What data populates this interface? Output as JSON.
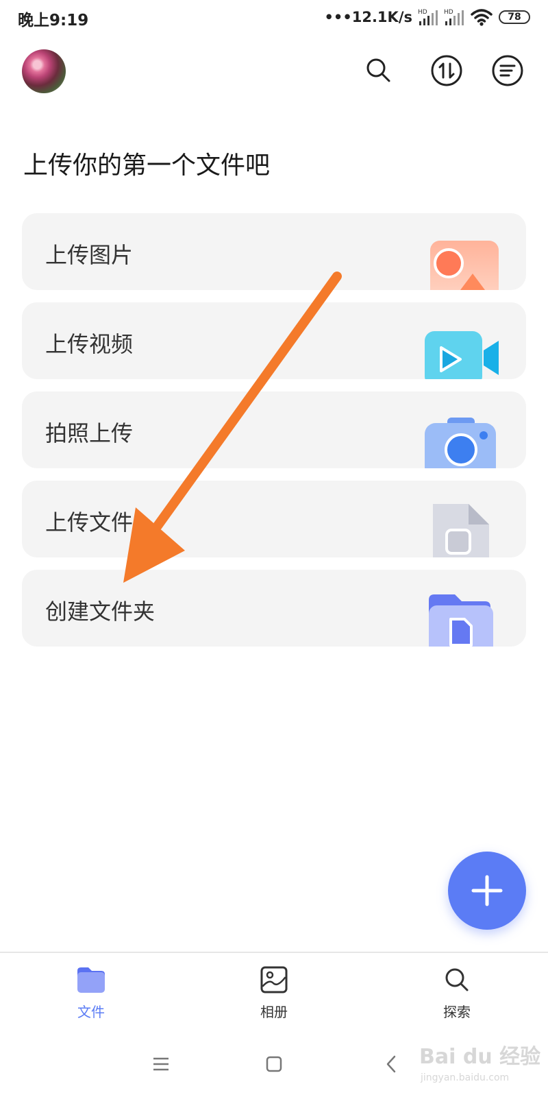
{
  "status_bar": {
    "time": "晚上9:19",
    "net_speed": "•••12.1K/s",
    "signal_1": "HD",
    "signal_2": "HD",
    "battery": "78"
  },
  "header": {
    "avatar": "avatar",
    "search_icon": "search-icon",
    "sort_icon": "sort-icon",
    "menu_icon": "menu-icon"
  },
  "main": {
    "heading": "上传你的第一个文件吧",
    "cards": [
      {
        "label": "上传图片",
        "icon": "image-icon"
      },
      {
        "label": "上传视频",
        "icon": "video-icon"
      },
      {
        "label": "拍照上传",
        "icon": "camera-icon"
      },
      {
        "label": "上传文件",
        "icon": "file-icon"
      },
      {
        "label": "创建文件夹",
        "icon": "folder-icon"
      }
    ]
  },
  "annotation": {
    "arrow_color": "#f47a2a"
  },
  "fab": {
    "icon": "plus-icon",
    "color": "#5b7cf5"
  },
  "bottom_nav": {
    "items": [
      {
        "label": "文件",
        "icon": "folder-icon",
        "active": true
      },
      {
        "label": "相册",
        "icon": "album-icon",
        "active": false
      },
      {
        "label": "探索",
        "icon": "search-icon",
        "active": false
      }
    ]
  },
  "system_nav": {
    "menu": "menu-icon",
    "home": "home-icon",
    "back": "back-icon"
  },
  "watermark": {
    "brand": "Bai du 经验",
    "url": "jingyan.baidu.com"
  },
  "colors": {
    "accent": "#5b7cf5",
    "card_bg": "#f4f4f4"
  }
}
